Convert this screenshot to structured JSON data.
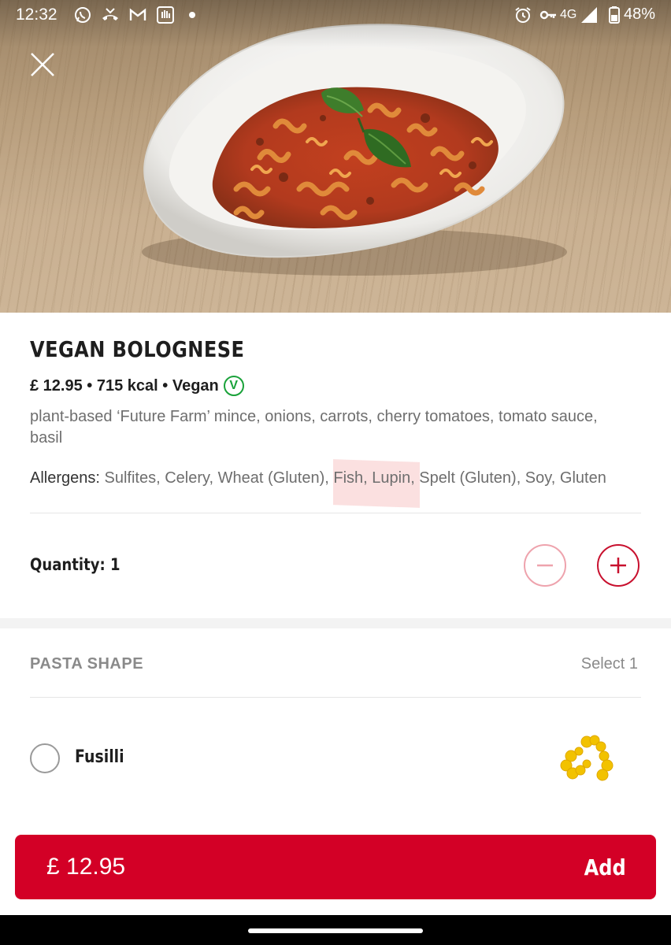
{
  "status_bar": {
    "time": "12:32",
    "network": "4G",
    "battery": "48%",
    "icons": [
      "whatsapp-icon",
      "missed-call-icon",
      "gmail-icon",
      "app-icon",
      "notification-dot-icon",
      "alarm-icon",
      "vpn-key-icon",
      "signal-icon",
      "battery-icon"
    ]
  },
  "product": {
    "title": "VEGAN BOLOGNESE",
    "price": "£ 12.95",
    "kcal": "715 kcal",
    "diet": "Vegan",
    "diet_badge": "V",
    "meta_separator": " • ",
    "description": "plant-based ‘Future Farm’ mince, onions, carrots, cherry tomatoes, tomato sauce, basil",
    "allergens_label": "Allergens",
    "allergens": "Sulfites, Celery, Wheat (Gluten), Fish, Lupin, Spelt (Gluten), Soy, Gluten"
  },
  "quantity": {
    "label": "Quantity: 1"
  },
  "options": {
    "section_title": "PASTA SHAPE",
    "select_hint": "Select 1",
    "items": [
      {
        "label": "Fusilli",
        "selected": false
      }
    ]
  },
  "footer": {
    "total": "£ 12.95",
    "add_label": "Add"
  },
  "colors": {
    "accent": "#d30026",
    "vegan_green": "#1aa23a",
    "muted_text": "#6e6e6e"
  }
}
